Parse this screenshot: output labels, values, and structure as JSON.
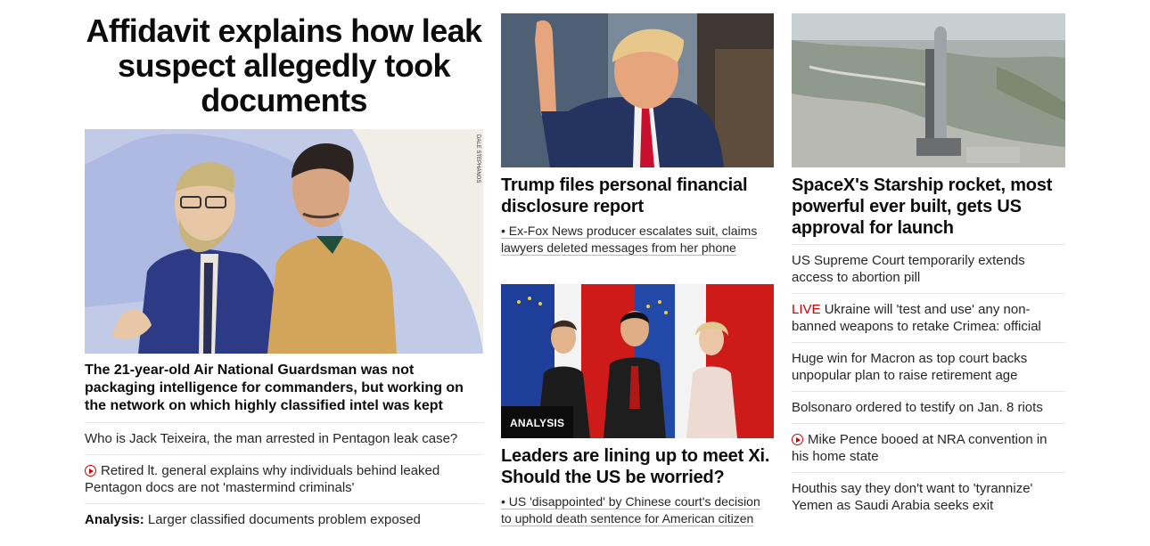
{
  "lead": {
    "headline": "Affidavit explains how leak suspect allegedly took documents",
    "image_credit": "DALE STEPHANOS",
    "description": "The 21-year-old Air National Guardsman was not packaging intelligence for commanders, but working on the network on which highly classified intel was kept",
    "links": [
      {
        "text": "Who is Jack Teixeira, the man arrested in Pentagon leak case?"
      },
      {
        "icon": "play-icon",
        "text": "Retired lt. general explains why individuals behind leaked Pentagon docs are not 'mastermind criminals'"
      },
      {
        "prefix": "Analysis:",
        "text": "Larger classified documents problem exposed"
      }
    ]
  },
  "trump": {
    "title": "Trump files personal financial disclosure report",
    "sub": "• Ex-Fox News producer escalates suit, claims lawyers deleted messages from her phone"
  },
  "xi": {
    "badge": "ANALYSIS",
    "title": "Leaders are lining up to meet Xi. Should the US be worried?",
    "sub": "• US 'disappointed' by Chinese court's decision to uphold death sentence for American citizen"
  },
  "spacex": {
    "title": "SpaceX's Starship rocket, most powerful ever built, gets US approval for launch",
    "links": [
      {
        "text": "US Supreme Court temporarily extends access to abortion pill"
      },
      {
        "live": "LIVE",
        "text": "Ukraine will 'test and use' any non-banned weapons to retake Crimea: official"
      },
      {
        "text": "Huge win for Macron as top court backs unpopular plan to raise retirement age"
      },
      {
        "text": "Bolsonaro ordered to testify on Jan. 8 riots"
      },
      {
        "icon": "play-icon",
        "text": "Mike Pence booed at NRA convention in his home state"
      },
      {
        "text": "Houthis say they don't want to 'tyrannize' Yemen as Saudi Arabia seeks exit"
      }
    ]
  },
  "colors": {
    "accent_red": "#cc0000",
    "text": "#0c0c0c",
    "divider": "#e6e6e6"
  }
}
